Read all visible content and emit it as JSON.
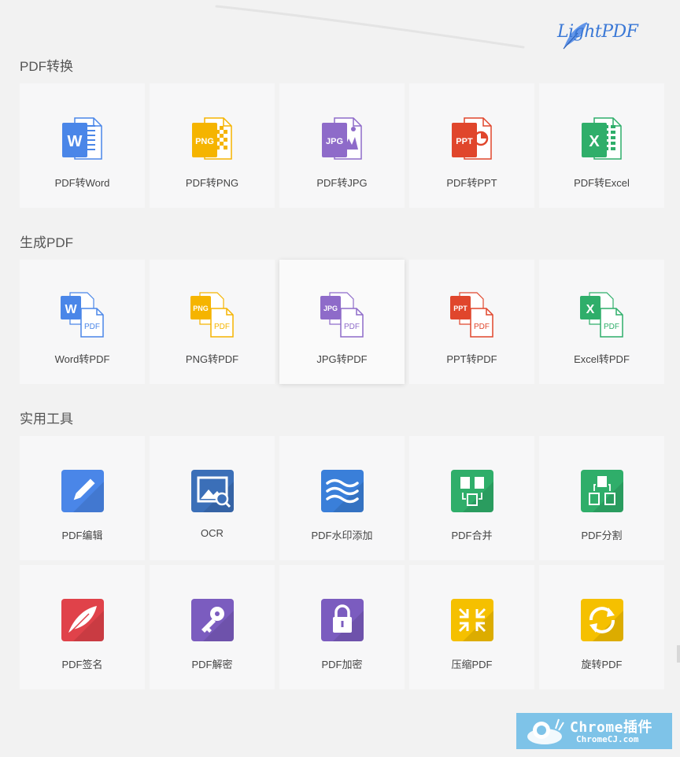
{
  "brand": {
    "logo_text": "LightPDF"
  },
  "sections": {
    "convert": {
      "title": "PDF转换",
      "items": [
        {
          "label": "PDF转Word",
          "icon": "word-doc-icon"
        },
        {
          "label": "PDF转PNG",
          "icon": "png-doc-icon"
        },
        {
          "label": "PDF转JPG",
          "icon": "jpg-doc-icon"
        },
        {
          "label": "PDF转PPT",
          "icon": "ppt-doc-icon"
        },
        {
          "label": "PDF转Excel",
          "icon": "excel-doc-icon"
        }
      ]
    },
    "create": {
      "title": "生成PDF",
      "items": [
        {
          "label": "Word转PDF",
          "icon": "word-to-pdf-icon"
        },
        {
          "label": "PNG转PDF",
          "icon": "png-to-pdf-icon"
        },
        {
          "label": "JPG转PDF",
          "icon": "jpg-to-pdf-icon"
        },
        {
          "label": "PPT转PDF",
          "icon": "ppt-to-pdf-icon"
        },
        {
          "label": "Excel转PDF",
          "icon": "excel-to-pdf-icon"
        }
      ]
    },
    "tools": {
      "title": "实用工具",
      "items": [
        {
          "label": "PDF编辑",
          "icon": "edit-pencil-icon"
        },
        {
          "label": "OCR",
          "icon": "ocr-scan-icon"
        },
        {
          "label": "PDF水印添加",
          "icon": "watermark-waves-icon"
        },
        {
          "label": "PDF合并",
          "icon": "merge-icon"
        },
        {
          "label": "PDF分割",
          "icon": "split-icon"
        },
        {
          "label": "PDF签名",
          "icon": "signature-feather-icon"
        },
        {
          "label": "PDF解密",
          "icon": "unlock-key-icon"
        },
        {
          "label": "PDF加密",
          "icon": "lock-icon"
        },
        {
          "label": "压缩PDF",
          "icon": "compress-icon"
        },
        {
          "label": "旋转PDF",
          "icon": "rotate-icon"
        }
      ]
    }
  },
  "doc_icon_tags": {
    "word": "W",
    "png": "PNG",
    "jpg": "JPG",
    "ppt": "PPT",
    "excel": "X",
    "pdf": "PDF"
  },
  "colors": {
    "word": "#4a86e8",
    "png": "#f5b400",
    "jpg": "#8e6bc9",
    "ppt": "#e0462c",
    "excel": "#2fae6a",
    "edit": "#4a86e8",
    "ocr": "#3b6fb8",
    "watermark": "#3a7fd9",
    "merge": "#2fae6a",
    "split": "#2fae6a",
    "sign": "#e0424a",
    "unlock": "#7b5cbf",
    "lock": "#7b5cbf",
    "compress": "#f5c000",
    "rotate": "#f5c000"
  },
  "watermark": {
    "title": "Chrome插件",
    "subtitle": "ChromeCJ.com"
  }
}
